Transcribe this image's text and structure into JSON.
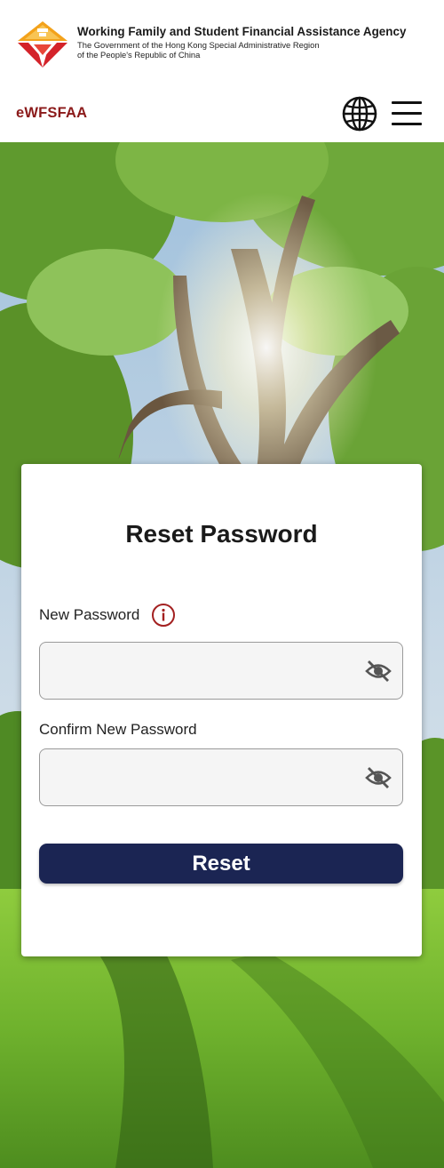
{
  "header": {
    "agency_name": "Working Family and Student Financial Assistance Agency",
    "agency_sub_line1": "The Government of the Hong Kong Special Administrative Region",
    "agency_sub_line2": "of the People's Republic of China",
    "brand": "eWFSFAA",
    "logo_icon": "wfsfaa-logo",
    "language_icon": "globe-icon",
    "menu_icon": "hamburger-menu-icon"
  },
  "form": {
    "title": "Reset Password",
    "new_password_label": "New Password",
    "new_password_value": "",
    "new_password_placeholder": "",
    "confirm_password_label": "Confirm New Password",
    "confirm_password_value": "",
    "confirm_password_placeholder": "",
    "info_icon": "info-icon",
    "visibility_icon": "eye-off-icon",
    "reset_label": "Reset"
  },
  "colors": {
    "brand": "#8b1a1a",
    "button": "#1b2553",
    "info": "#a32020"
  }
}
